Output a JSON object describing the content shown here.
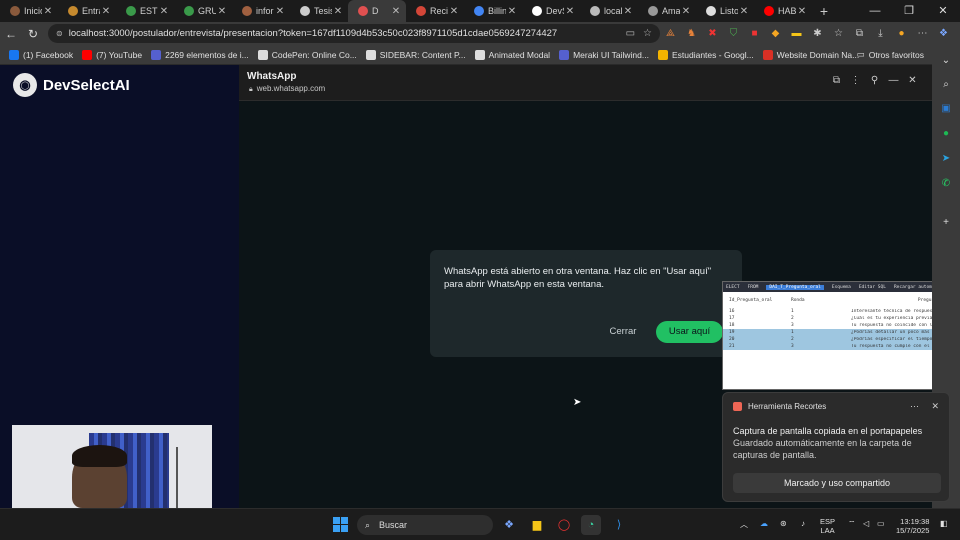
{
  "tabs": [
    {
      "label": "Inicio",
      "color": "#8a5a3c"
    },
    {
      "label": "Entrar",
      "color": "#c68a2e"
    },
    {
      "label": "ESTUI",
      "color": "#3a9a4a"
    },
    {
      "label": "GRUP",
      "color": "#3a9a4a"
    },
    {
      "label": "inform",
      "color": "#a06040"
    },
    {
      "label": "Tesis",
      "color": "#cccccc"
    },
    {
      "label": "D",
      "color": "#e05050",
      "active": true
    },
    {
      "label": "Recibi",
      "color": "#d44638"
    },
    {
      "label": "Billing",
      "color": "#4285f4"
    },
    {
      "label": "DevSe",
      "color": "#ffffff"
    },
    {
      "label": "localh",
      "color": "#bbbbbb"
    },
    {
      "label": "Amaz",
      "color": "#999999"
    },
    {
      "label": "Listo c",
      "color": "#dddddd"
    },
    {
      "label": "HABL",
      "color": "#ff0000"
    }
  ],
  "address": {
    "url": "localhost:3000/postulador/entrevista/presentacion?token=167df1109d4b53c50c023f8971105d1cdae0569247274427"
  },
  "bookmarks": [
    {
      "label": "(1) Facebook",
      "color": "#1877f2"
    },
    {
      "label": "(7) YouTube",
      "color": "#ff0000"
    },
    {
      "label": "2269 elementos de i...",
      "color": "#5560d0"
    },
    {
      "label": "CodePen: Online Co...",
      "color": "#dddddd"
    },
    {
      "label": "SIDEBAR: Content P...",
      "color": "#dddddd"
    },
    {
      "label": "Animated Modal",
      "color": "#dddddd"
    },
    {
      "label": "Meraki UI Tailwind...",
      "color": "#5560d0"
    },
    {
      "label": "Estudiantes - Googl...",
      "color": "#f4b400"
    },
    {
      "label": "Website Domain Na...",
      "color": "#d93025"
    }
  ],
  "other_bookmarks": "Otros favoritos",
  "app": {
    "brand": "DevSelectAI"
  },
  "panel": {
    "title": "WhatsApp",
    "domain": "web.whatsapp.com",
    "dialog_text": "WhatsApp está abierto en otra ventana. Haz clic en \"Usar aquí\" para abrir WhatsApp en esta ventana.",
    "cancel_label": "Cerrar",
    "confirm_label": "Usar aquí",
    "accent": "#21c063"
  },
  "sql": {
    "toolbar": [
      "ELECT",
      "FROM",
      "DAI_T_Pregunta_oral",
      "Esquema",
      "Editar SQL",
      "Recargar automat"
    ],
    "headers": [
      "Id_Pregunta_oral",
      "Ronda",
      "PreguntaIA"
    ],
    "rows": [
      [
        "16",
        "1",
        "Interesante técnica de respuesta, ¿puedes"
      ],
      [
        "17",
        "2",
        "¿Cuál es tu experiencia previa en el desa"
      ],
      [
        "18",
        "3",
        "Tu respuesta no coincide con la solicitud"
      ],
      [
        "19",
        "1",
        "¿Podrías detallar un poco más sobre el p"
      ],
      [
        "20",
        "2",
        "¿Podrías especificar el tiempo experienci"
      ],
      [
        "21",
        "3",
        "Tu respuesta no cumple con el nivel de p"
      ]
    ],
    "highlighted_rows": [
      3,
      4,
      5
    ]
  },
  "toast": {
    "app": "Herramienta Recortes",
    "title": "Captura de pantalla copiada en el portapapeles",
    "body": "Guardado automáticamente en la carpeta de capturas de pantalla.",
    "button": "Marcado y uso compartido"
  },
  "taskbar": {
    "search_placeholder": "Buscar",
    "lang_line1": "ESP",
    "lang_line2": "LAA",
    "time": "13:19:38",
    "date": "15/7/2025"
  }
}
